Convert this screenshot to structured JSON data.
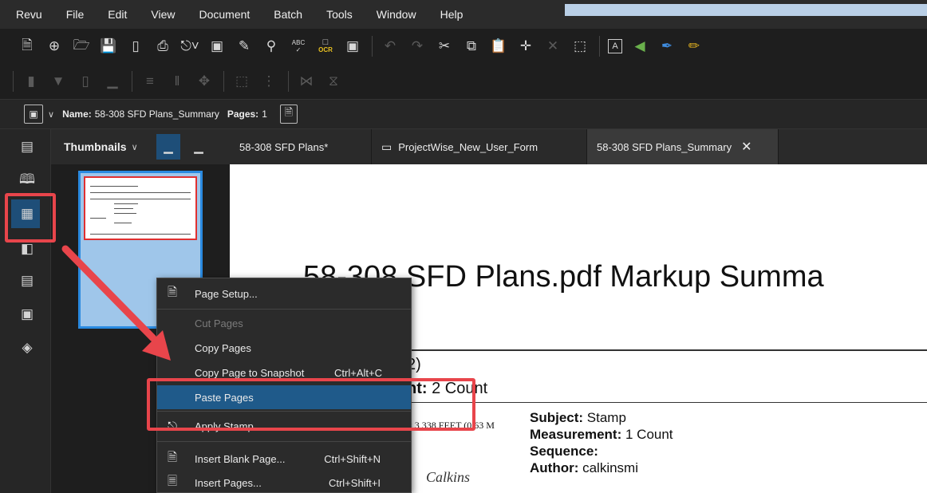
{
  "menubar": {
    "items": [
      "Revu",
      "File",
      "Edit",
      "View",
      "Document",
      "Batch",
      "Tools",
      "Window",
      "Help"
    ]
  },
  "toolbar1": {
    "icons": [
      "new-document-icon",
      "add-icon",
      "open-folder-icon",
      "save-icon",
      "page-icon",
      "print-icon",
      "stamp-dropdown-icon",
      "3d-cube-icon",
      "edit-document-icon",
      "search-icon",
      "spellcheck-icon",
      "ocr-icon",
      "crop-icon",
      "undo-icon",
      "redo-icon",
      "scissors-icon",
      "copy-icon",
      "paste-icon",
      "format-painter-icon",
      "delete-icon",
      "select-region-icon",
      "textbox-icon",
      "highlight-icon",
      "pen-icon",
      "eraser-icon"
    ],
    "ocr_label": "OCR",
    "abc_label": "ABC"
  },
  "toolbar2": {
    "icons": [
      "align-left-icon",
      "align-top-icon",
      "align-right-icon",
      "align-bottom-icon",
      "distribute-h-icon",
      "distribute-v-icon",
      "move-icon",
      "group-icon",
      "ungroup-icon",
      "flip-h-icon",
      "flip-v-icon"
    ]
  },
  "infobar": {
    "name_label": "Name:",
    "name_value": "58-308 SFD Plans_Summary",
    "pages_label": "Pages:",
    "pages_value": "1"
  },
  "thumbnails": {
    "title": "Thumbnails"
  },
  "tabs": [
    {
      "label": "58-308 SFD Plans*"
    },
    {
      "label": "ProjectWise_New_User_Form"
    },
    {
      "label": "58-308 SFD Plans_Summary"
    }
  ],
  "document": {
    "title": "58-308 SFD Plans.pdf Markup Summa",
    "line1": "2)",
    "line2_bold": "nt:",
    "line2_rest": " 2 Count",
    "measure_small": "= 3,338 FEET (0.63 M",
    "subject_label": "Subject:",
    "subject_value": " Stamp",
    "measurement_label": "Measurement:",
    "measurement_value": " 1 Count",
    "sequence_label": "Sequence:",
    "author_label": "Author:",
    "author_value": " calkinsmi",
    "signature": "Calkins"
  },
  "context_menu": {
    "items": [
      {
        "label": "Page Setup...",
        "shortcut": "",
        "state": "normal"
      },
      {
        "label": "Cut Pages",
        "shortcut": "",
        "state": "disabled"
      },
      {
        "label": "Copy Pages",
        "shortcut": "",
        "state": "normal"
      },
      {
        "label": "Copy Page to Snapshot",
        "shortcut": "Ctrl+Alt+C",
        "state": "normal"
      },
      {
        "label": "Paste Pages",
        "shortcut": "",
        "state": "highlighted"
      },
      {
        "label": "Apply Stamp...",
        "shortcut": "",
        "state": "normal"
      },
      {
        "label": "Insert Blank Page...",
        "shortcut": "Ctrl+Shift+N",
        "state": "normal"
      },
      {
        "label": "Insert Pages...",
        "shortcut": "Ctrl+Shift+I",
        "state": "normal"
      }
    ]
  },
  "colors": {
    "annotation_red": "#e8454b",
    "highlight_blue": "#1f5a8a",
    "active_blue": "#1e4e78"
  }
}
